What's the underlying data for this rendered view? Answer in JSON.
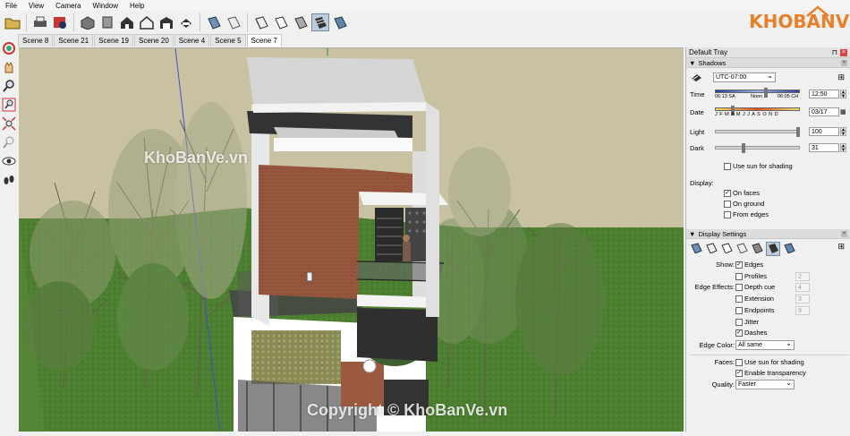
{
  "menu": [
    "File",
    "View",
    "Camera",
    "Window",
    "Help"
  ],
  "toolbar_icons": [
    "open-icon",
    "print-icon",
    "model-info-icon",
    "shaded-view-icon",
    "components-icon",
    "home-icon",
    "home-outline-icon",
    "warehouse-icon",
    "iso-view-icon",
    "top-view-icon",
    "xray-icon",
    "wireframe-icon",
    "hidden-line-icon",
    "shaded-icon",
    "shaded-textures-icon",
    "monochrome-icon"
  ],
  "scene_tabs": [
    "Scene 8",
    "Scene 21",
    "Scene 19",
    "Scene 20",
    "Scene 4",
    "Scene 5",
    "Scene 7"
  ],
  "active_tab": "Scene 7",
  "left_tools": [
    "orbit-icon",
    "pan-icon",
    "zoom-icon",
    "zoom-window-icon",
    "zoom-extents-icon",
    "previous-view-icon",
    "look-around-icon",
    "walk-icon"
  ],
  "watermark_top": "KhoBanVe.vn",
  "watermark_bottom": "Copyright © KhoBanVe.vn",
  "logo_text": "KHOBANVE",
  "tray": {
    "title": "Default Tray",
    "shadows": {
      "header": "Shadows",
      "timezone": "UTC-07:00",
      "time_label": "Time",
      "time_start": "06:13 SA",
      "time_mid": "Noon",
      "time_end": "06:05 CH",
      "time_value": "12:50",
      "date_label": "Date",
      "months": "J F M A M J J A S O N D",
      "date_value": "03/17",
      "light_label": "Light",
      "light_value": "100",
      "dark_label": "Dark",
      "dark_value": "31",
      "use_sun": "Use sun for shading",
      "display_label": "Display:",
      "on_faces": "On faces",
      "on_ground": "On ground",
      "from_edges": "From edges"
    },
    "display": {
      "header": "Display Settings",
      "show_label": "Show:",
      "edges": "Edges",
      "profiles": "Profiles",
      "profiles_val": "2",
      "edge_effects_label": "Edge Effects:",
      "depth_cue": "Depth cue",
      "depth_val": "4",
      "extension": "Extension",
      "extension_val": "3",
      "endpoints": "Endpoints",
      "endpoints_val": "9",
      "jitter": "Jitter",
      "dashes": "Dashes",
      "edge_color_label": "Edge Color:",
      "edge_color": "All same",
      "faces_label": "Faces:",
      "use_sun": "Use sun for shading",
      "enable_transparency": "Enable transparency",
      "quality_label": "Quality:",
      "quality": "Faster"
    }
  },
  "colors": {
    "sky": "#c9c2a2",
    "grass": "#4d7f30",
    "brick": "#9b5a40",
    "accent_orange": "#e8802a"
  }
}
